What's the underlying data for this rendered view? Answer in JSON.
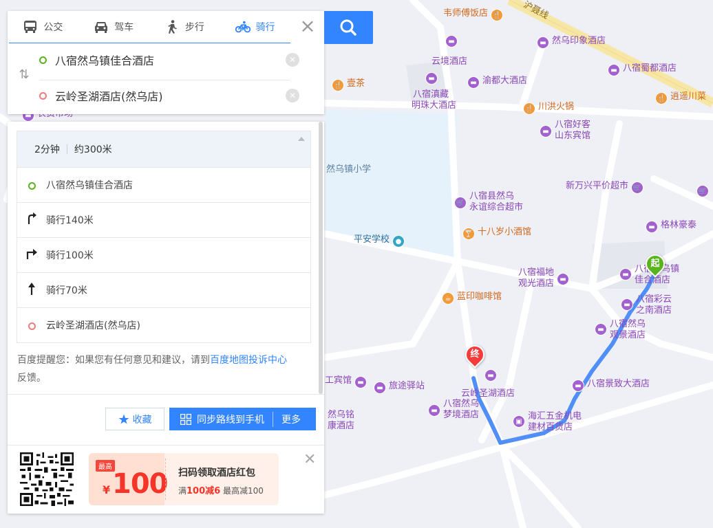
{
  "colors": {
    "accent": "#3385ff",
    "route": "#4f8ff7",
    "start": "#58b31c",
    "end": "#f53c3c",
    "hotel": "#a261cf",
    "food": "#f29a3a"
  },
  "tabs": [
    {
      "label": "公交",
      "icon": "bus-icon"
    },
    {
      "label": "驾车",
      "icon": "car-icon"
    },
    {
      "label": "步行",
      "icon": "walk-icon"
    },
    {
      "label": "骑行",
      "icon": "bike-icon",
      "active": true
    }
  ],
  "route": {
    "origin": "八宿然乌镇佳合酒店",
    "destination": "云岭圣湖酒店(然乌店)"
  },
  "summary": {
    "duration": "2分钟",
    "distance": "约300米"
  },
  "steps": [
    {
      "icon": "start-dot-icon",
      "text": "八宿然乌镇佳合酒店"
    },
    {
      "icon": "turn-left-arrow-icon",
      "text": "骑行140米"
    },
    {
      "icon": "turn-right-arrow-icon",
      "text": "骑行100米"
    },
    {
      "icon": "straight-arrow-icon",
      "text": "骑行70米"
    },
    {
      "icon": "end-dot-icon",
      "text": "云岭圣湖酒店(然乌店)"
    }
  ],
  "tip": {
    "prefix": "百度提醒您：如果您有任何意见和建议，请到",
    "link": "百度地图投诉中心",
    "suffix": "反馈。"
  },
  "actions": {
    "favorite": "收藏",
    "sync": "同步路线到手机",
    "more": "更多"
  },
  "promo": {
    "tag": "最高",
    "currency": "¥",
    "amount": "100",
    "title": "扫码领取酒店红包",
    "rule_prefix": "满",
    "rule_highlight": "100减6",
    "rule_suffix": "最高减100"
  },
  "markers": {
    "start": "起",
    "end": "终"
  },
  "map": {
    "road_label": "沪聂线",
    "pois": [
      {
        "name": [
          "韦师傅饭店"
        ],
        "kind": "food"
      },
      {
        "name": [
          "然乌印象酒店"
        ],
        "kind": "hotel"
      },
      {
        "name": [
          "云境酒店"
        ],
        "kind": "hotel"
      },
      {
        "name": [
          "八宿蜀都酒店"
        ],
        "kind": "hotel"
      },
      {
        "name": [
          "壹茶"
        ],
        "kind": "food"
      },
      {
        "name": [
          "渝都大酒店"
        ],
        "kind": "hotel"
      },
      {
        "name": [
          "八宿滇藏",
          "明珠大酒店"
        ],
        "kind": "hotel"
      },
      {
        "name": [
          "逍遥川菜"
        ],
        "kind": "food"
      },
      {
        "name": [
          "川洪火锅"
        ],
        "kind": "food"
      },
      {
        "name": [
          "八宿好客",
          "山东宾馆"
        ],
        "kind": "hotel"
      },
      {
        "name": [
          "农贸市场"
        ],
        "kind": "hotel"
      },
      {
        "name": [
          "然乌镇小学"
        ],
        "kind": "text"
      },
      {
        "name": [
          "八宿县然乌",
          "永谊综合超市"
        ],
        "kind": "hotel"
      },
      {
        "name": [
          "新万兴平价超市"
        ],
        "kind": "hotel"
      },
      {
        "name": [
          "格林豪泰"
        ],
        "kind": "hotel"
      },
      {
        "name": [
          "十八岁小酒馆"
        ],
        "kind": "food"
      },
      {
        "name": [
          "平安学校"
        ],
        "kind": "blue"
      },
      {
        "name": [
          "八宿福地",
          "观光酒店"
        ],
        "kind": "hotel"
      },
      {
        "name": [
          "八宿然乌镇",
          "佳合酒店"
        ],
        "kind": "hotel"
      },
      {
        "name": [
          "八宿彩云",
          "之南酒店"
        ],
        "kind": "hotel"
      },
      {
        "name": [
          "蓝印咖啡馆"
        ],
        "kind": "food"
      },
      {
        "name": [
          "八宿然乌",
          "观景酒店"
        ],
        "kind": "hotel"
      },
      {
        "name": [
          "云岭圣湖酒店"
        ],
        "kind": "hotel"
      },
      {
        "name": [
          "工宾馆"
        ],
        "kind": "hotel"
      },
      {
        "name": [
          "旅途驿站"
        ],
        "kind": "hotel"
      },
      {
        "name": [
          "八宿景致大酒店"
        ],
        "kind": "hotel"
      },
      {
        "name": [
          "八宿然乌",
          "梦境酒店"
        ],
        "kind": "hotel"
      },
      {
        "name": [
          "然乌铭",
          "康酒店"
        ],
        "kind": "text"
      },
      {
        "name": [
          "海汇五金机电",
          "建材百货店"
        ],
        "kind": "hotel"
      }
    ]
  }
}
